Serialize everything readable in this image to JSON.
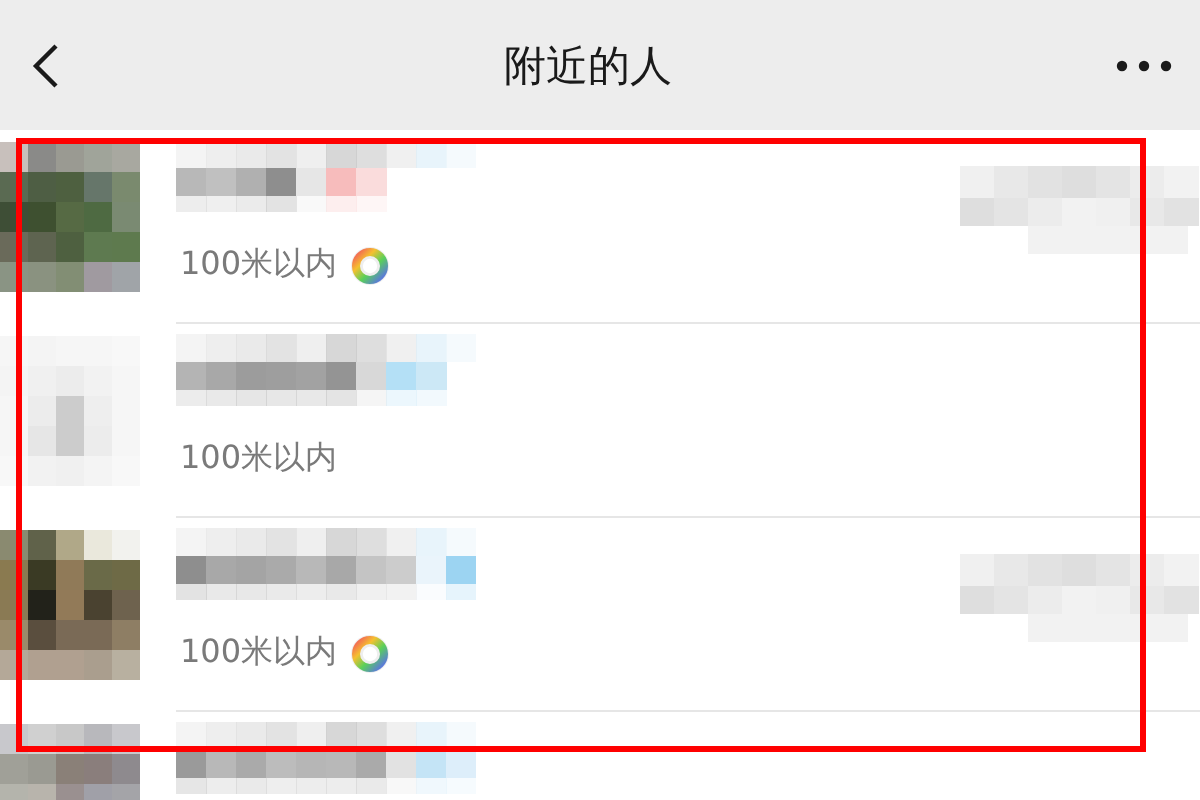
{
  "header": {
    "title": "附近的人"
  },
  "people": [
    {
      "distance": "100米以内",
      "moments": true,
      "avatar": {
        "kind": "picture"
      },
      "album": {
        "kind": "picture"
      }
    },
    {
      "distance": "100米以内",
      "moments": false,
      "avatar": {
        "kind": "picture"
      }
    },
    {
      "distance": "100米以内",
      "moments": true,
      "avatar": {
        "kind": "picture"
      },
      "album": {
        "kind": "picture"
      }
    },
    {
      "avatar": {
        "kind": "picture"
      }
    }
  ]
}
